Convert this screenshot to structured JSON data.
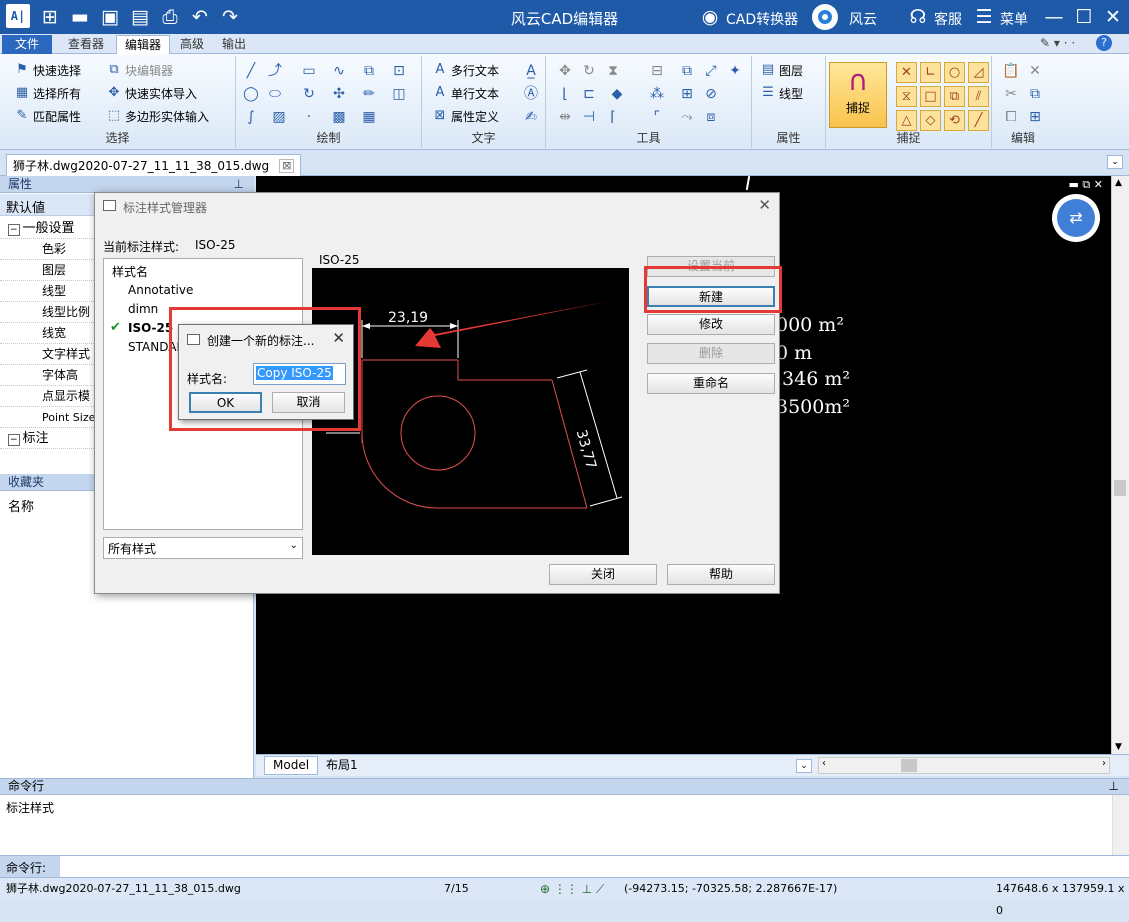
{
  "titlebar": {
    "app_title": "风云CAD编辑器",
    "logo_text": "A|",
    "converter_label": "CAD转换器",
    "fengyun_label": "风云",
    "service_label": "客服",
    "menu_label": "菜单"
  },
  "menu_tabs": [
    "文件",
    "查看器",
    "编辑器",
    "高级",
    "输出"
  ],
  "ribbon": {
    "select": {
      "label": "选择",
      "items": [
        "快速选择",
        "块编辑器",
        "选择所有",
        "快速实体导入",
        "匹配属性",
        "多边形实体输入"
      ]
    },
    "draw": {
      "label": "绘制"
    },
    "text": {
      "label": "文字",
      "items": [
        "多行文本",
        "单行文本",
        "属性定义"
      ]
    },
    "tools": {
      "label": "工具"
    },
    "properties": {
      "label": "属性",
      "items": [
        "图层",
        "线型"
      ]
    },
    "snap": {
      "label": "捕捉",
      "big_button": "捕捉"
    },
    "edit": {
      "label": "编辑"
    }
  },
  "document_tab": "狮子林.dwg2020-07-27_11_11_38_015.dwg",
  "left_panel": {
    "properties_header": "属性",
    "default_value": "默认値",
    "general_group": "一般设置",
    "general_items": [
      "色彩",
      "图层",
      "线型",
      "线型比例",
      "线宽",
      "文字样式",
      "字体高",
      "点显示模",
      "Point Size"
    ],
    "dimension_group": "标注",
    "favorites_header": "收藏夹",
    "favorites_name": "名称"
  },
  "canvas_text": {
    "line1": "000 m²",
    "line2": "0 m",
    "line3": ".346 m²",
    "line4": "3500m²"
  },
  "layout_tabs": [
    "Model",
    "布局1"
  ],
  "command": {
    "header": "命令行",
    "log": "标注样式",
    "input_label": "命令行:"
  },
  "statusbar": {
    "file": "狮子林.dwg2020-07-27_11_11_38_015.dwg",
    "page": "7/15",
    "coords": "(-94273.15; -70325.58; 2.287667E-17)",
    "size": "147648.6 x 137959.1 x 0"
  },
  "dim_dialog": {
    "title": "标注样式管理器",
    "current_label": "当前标注样式:",
    "current_value": "ISO-25",
    "list_header": "样式名",
    "styles": [
      "Annotative",
      "dimn",
      "ISO-25",
      "STANDARD"
    ],
    "selected_style": "ISO-25",
    "preview_label": "ISO-25",
    "filter": "所有样式",
    "buttons": {
      "set_current": "设置当前",
      "new": "新建",
      "modify": "修改",
      "delete": "删除",
      "rename": "重命名",
      "close": "关闭",
      "help": "帮助"
    },
    "preview_dims": {
      "horizontal": "23,19",
      "aligned": "33,77"
    }
  },
  "new_dialog": {
    "title": "创建一个新的标注...",
    "name_label": "样式名:",
    "name_value": "Copy ISO-25",
    "ok": "OK",
    "cancel": "取消"
  },
  "colors": {
    "titlebar": "#1e5aa8",
    "highlight": "#e53935",
    "preview_geometry": "#e05050"
  }
}
